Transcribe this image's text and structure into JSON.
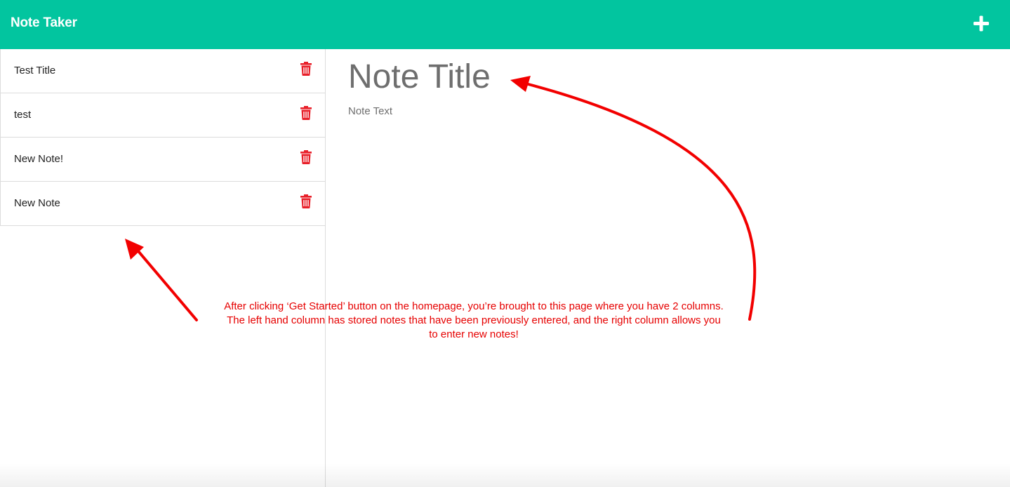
{
  "navbar": {
    "brand": "Note Taker",
    "add_icon": "plus-icon"
  },
  "colors": {
    "navbar_bg": "#02c59f",
    "trash": "#e8202a",
    "annotation": "#e60000",
    "placeholder": "#6e6e6e"
  },
  "sidebar": {
    "notes": [
      {
        "title": "Test Title",
        "icon": "trash-icon"
      },
      {
        "title": "test",
        "icon": "trash-icon"
      },
      {
        "title": "New Note!",
        "icon": "trash-icon"
      },
      {
        "title": "New Note",
        "icon": "trash-icon"
      }
    ]
  },
  "editor": {
    "title_placeholder": "Note Title",
    "text_placeholder": "Note Text"
  },
  "annotation": {
    "line1": "After clicking ‘Get Started’ button on the homepage, you’re brought to this page where you have 2 columns.",
    "line2": "The left hand column has stored notes that have been previously entered, and the right column allows you",
    "line3": "to enter new notes!"
  }
}
